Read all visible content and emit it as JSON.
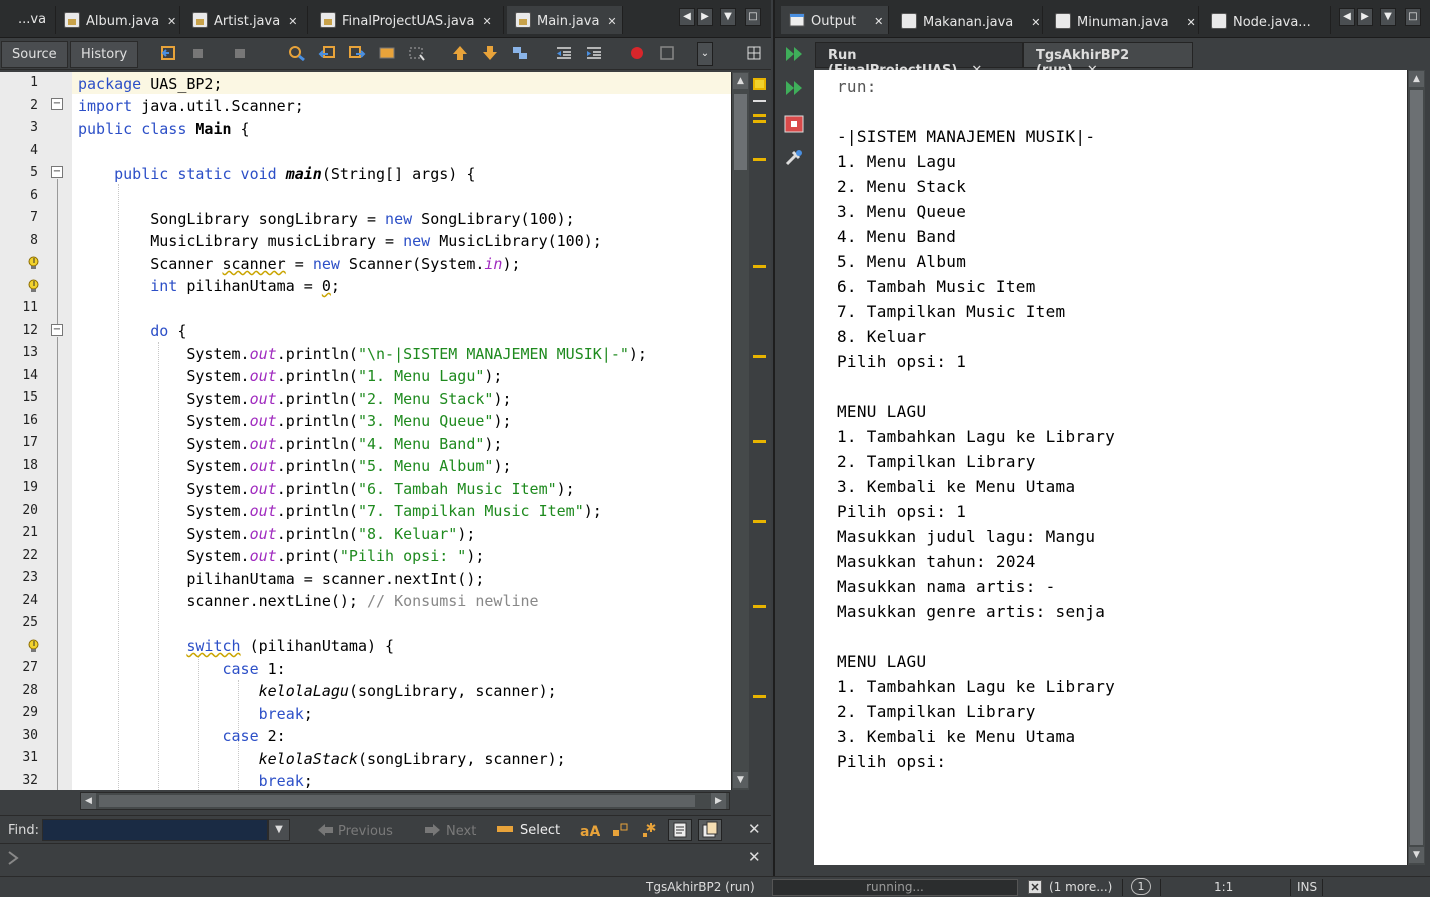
{
  "editor": {
    "tabs": [
      {
        "label": "...va",
        "icon": "java-file-icon"
      },
      {
        "label": "Album.java",
        "icon": "java-file-icon"
      },
      {
        "label": "Artist.java",
        "icon": "java-file-icon"
      },
      {
        "label": "FinalProjectUAS.java",
        "icon": "java-main-file-icon"
      },
      {
        "label": "Main.java",
        "icon": "java-main-file-icon",
        "active": true
      }
    ],
    "close_glyph": "✕",
    "toolbar": {
      "source_label": "Source",
      "history_label": "History"
    },
    "line_numbers": [
      "1",
      "2",
      "3",
      "4",
      "5",
      "6",
      "7",
      "8",
      "",
      "",
      "11",
      "12",
      "13",
      "14",
      "15",
      "16",
      "17",
      "18",
      "19",
      "20",
      "21",
      "22",
      "23",
      "24",
      "25",
      "",
      "27",
      "28",
      "29",
      "30",
      "31",
      "32"
    ],
    "find": {
      "label": "Find:",
      "value": "",
      "previous_label": "Previous",
      "next_label": "Next",
      "select_label": "Select"
    },
    "run_label": "TgsAkhirBP2 (run)"
  },
  "code": {
    "l1a": "package",
    "l1b": " UAS_BP2;",
    "l2a": "import",
    "l2b": " java.util.Scanner;",
    "l3a": "public class",
    "l3b": " ",
    "l3c": "Main",
    "l3d": " {",
    "l5a": "    public static void",
    "l5b": " ",
    "l5c": "main",
    "l5d": "(String[] args) {",
    "l7a": "        SongLibrary songLibrary = ",
    "l7b": "new",
    "l7c": " SongLibrary(100);",
    "l8a": "        MusicLibrary musicLibrary = ",
    "l8b": "new",
    "l8c": " MusicLibrary(100);",
    "l9a": "        Scanner ",
    "l9b": "scanner",
    "l9c": " = ",
    "l9d": "new",
    "l9e": " Scanner(System.",
    "l9f": "in",
    "l9g": ");",
    "l10a": "        ",
    "l10b": "int",
    "l10c": " pilihanUtama = ",
    "l10d": "0",
    "l10e": ";",
    "l12a": "        ",
    "l12b": "do",
    "l12c": " {",
    "l13a": "            System.",
    "l13b": "out",
    "l13c": ".println(",
    "l13d": "\"\\n-|SISTEM MANAJEMEN MUSIK|-\"",
    "l13e": ");",
    "l14d": "\"1. Menu Lagu\"",
    "l15d": "\"2. Menu Stack\"",
    "l16d": "\"3. Menu Queue\"",
    "l17d": "\"4. Menu Band\"",
    "l18d": "\"5. Menu Album\"",
    "l19d": "\"6. Tambah Music Item\"",
    "l20d": "\"7. Tampilkan Music Item\"",
    "l21d": "\"8. Keluar\"",
    "l22c": ".print(",
    "l22d": "\"Pilih opsi: \"",
    "l23": "            pilihanUtama = scanner.nextInt();",
    "l24a": "            scanner.nextLine(); ",
    "l24b": "// Konsumsi newline",
    "l26a": "            ",
    "l26b": "switch",
    "l26c": " (pilihanUtama) {",
    "l27a": "                ",
    "l27b": "case",
    "l27c": " 1:",
    "l28a": "                    ",
    "l28b": "kelolaLagu",
    "l28c": "(songLibrary, scanner);",
    "l29a": "                    ",
    "l29b": "break",
    "l29c": ";",
    "l30a": "                ",
    "l30b": "case",
    "l30c": " 2:",
    "l31a": "                    ",
    "l31b": "kelolaStack",
    "l31c": "(songLibrary, scanner);",
    "l32a": "                    ",
    "l32b": "break",
    "l32c": ";"
  },
  "output": {
    "tabs": [
      {
        "label": "Output",
        "icon": "output-icon",
        "active": true
      },
      {
        "label": "Makanan.java",
        "icon": "java-main-file-icon"
      },
      {
        "label": "Minuman.java",
        "icon": "java-main-file-icon"
      },
      {
        "label": "Node.java...",
        "icon": "java-file-icon"
      }
    ],
    "subtabs": [
      "Run (FinalProjectUAS)",
      "TgsAkhirBP2 (run)"
    ],
    "lines": [
      "run:",
      "",
      "-|SISTEM MANAJEMEN MUSIK|-",
      "1. Menu Lagu",
      "2. Menu Stack",
      "3. Menu Queue",
      "4. Menu Band",
      "5. Menu Album",
      "6. Tambah Music Item",
      "7. Tampilkan Music Item",
      "8. Keluar",
      "Pilih opsi: 1",
      "",
      "MENU LAGU",
      "1. Tambahkan Lagu ke Library",
      "2. Tampilkan Library",
      "3. Kembali ke Menu Utama",
      "Pilih opsi: 1",
      "Masukkan judul lagu: Mangu",
      "Masukkan tahun: 2024",
      "Masukkan nama artis: -",
      "Masukkan genre artis: senja",
      "",
      "MENU LAGU",
      "1. Tambahkan Lagu ke Library",
      "2. Tampilkan Library",
      "3. Kembali ke Menu Utama",
      "Pilih opsi:"
    ]
  },
  "status": {
    "running_task": "TgsAkhirBP2 (run)",
    "progress_text": "running...",
    "more_tasks": "(1 more...)",
    "notifications": "1",
    "position": "1:1",
    "insert_mode": "INS"
  },
  "colors": {
    "keyword": "#2c4fc7",
    "string": "#1e8a1e",
    "field": "#a02bbf",
    "warning": "#e8b400",
    "background_dark": "#3c3f41"
  }
}
